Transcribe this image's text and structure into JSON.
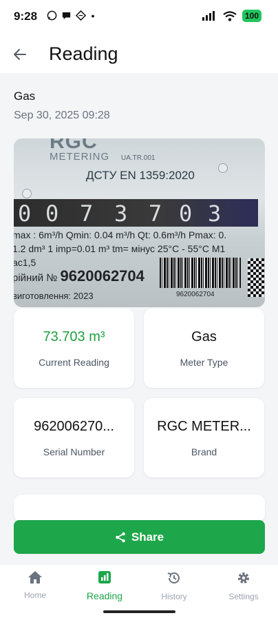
{
  "status_bar": {
    "time": "9:28",
    "battery": "100"
  },
  "app_bar": {
    "title": "Reading"
  },
  "reading": {
    "meter_name": "Gas",
    "timestamp": "Sep 30, 2025 09:28"
  },
  "photo": {
    "brand_text": "RGC",
    "metering_text": "METERING",
    "ua_tr": "UA.TR.001",
    "standard": "ДСТУ EN 1359:2020",
    "digits": [
      "0",
      "0",
      "7",
      "3",
      "7",
      "0",
      "3"
    ],
    "spec_line1": "max : 6m³/h   Qmin: 0.04 m³/h   Qt: 0.6m³/h   Pmax: 0.",
    "spec_line2": "1.2 dm³   1 imp=0.01 m³  tm= мінус 25°C - 55°C M1",
    "spec_line3": "ас1,5",
    "serial_label": "рійний №",
    "serial_value": "9620062704",
    "year_line": "виготовлення:  2023",
    "barcode_number": "9620062704"
  },
  "cards": {
    "current_reading": {
      "value": "73.703 m³",
      "label": "Current Reading"
    },
    "meter_type": {
      "value": "Gas",
      "label": "Meter Type"
    },
    "serial_number": {
      "value": "962006270...",
      "label": "Serial Number"
    },
    "brand": {
      "value": "RGC METER...",
      "label": "Brand"
    }
  },
  "share_button": {
    "label": "Share"
  },
  "bottom_nav": {
    "items": [
      {
        "label": "Home",
        "icon": "home-icon"
      },
      {
        "label": "Reading",
        "icon": "reading-icon"
      },
      {
        "label": "History",
        "icon": "history-icon"
      },
      {
        "label": "Settings",
        "icon": "settings-icon"
      }
    ],
    "active": "Reading"
  },
  "colors": {
    "accent": "#1ea64a",
    "reading_value": "#1e9e3e",
    "muted_text": "#6b7280",
    "background": "#f4f5f7"
  }
}
